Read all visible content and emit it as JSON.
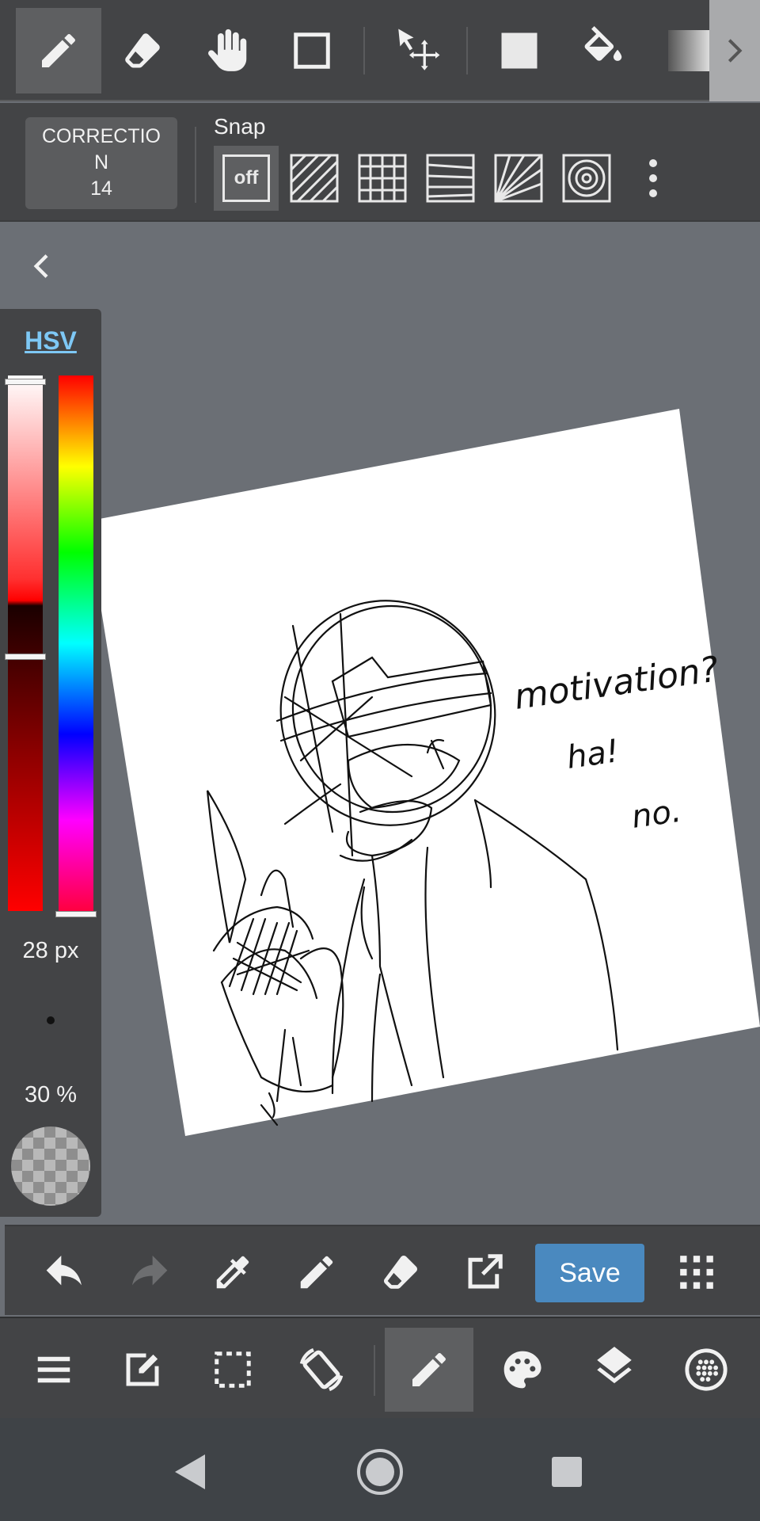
{
  "top_toolbar": {
    "tools": [
      "pen",
      "eraser",
      "hand",
      "rectangle",
      "move",
      "fill-color",
      "bucket",
      "gradient"
    ],
    "active_tool": "pen"
  },
  "snap_bar": {
    "correction_label_line1": "CORRECTIO",
    "correction_label_line2": "N",
    "correction_value": "14",
    "snap_label": "Snap",
    "snap_off_text": "off"
  },
  "color_panel": {
    "mode_label": "HSV",
    "brush_size": "28 px",
    "opacity": "30 %"
  },
  "canvas": {
    "note_line1": "motivation?",
    "note_line2": "ha!",
    "note_line3": "no."
  },
  "action_bar": {
    "save_label": "Save"
  },
  "colors": {
    "toolbar_bg": "#434446",
    "canvas_bg": "#6b6f75",
    "accent_blue": "#4a89bf",
    "hsv_link": "#7ec8f5"
  }
}
